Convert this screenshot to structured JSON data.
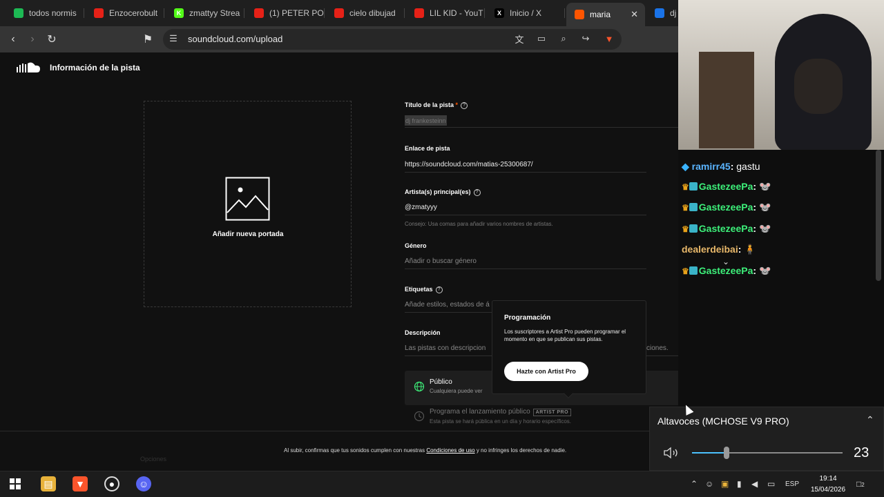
{
  "tabs": [
    {
      "label": "todos normis",
      "color": "#1db954",
      "glyph": ""
    },
    {
      "label": "Enzocerobult",
      "color": "#e62117",
      "glyph": ""
    },
    {
      "label": "zmattyy Strea",
      "color": "#53fc18",
      "glyph": "K"
    },
    {
      "label": "(1) PETER PO",
      "color": "#e62117",
      "glyph": ""
    },
    {
      "label": "cielo dibujad",
      "color": "#e62117",
      "glyph": ""
    },
    {
      "label": "LIL KID - YouT",
      "color": "#e62117",
      "glyph": ""
    },
    {
      "label": "Inicio / X",
      "color": "#000000",
      "glyph": "X"
    },
    {
      "label": "maria",
      "color": "#ff5500",
      "glyph": "",
      "active": true
    },
    {
      "label": "dj",
      "color": "#1a73e8",
      "glyph": ""
    }
  ],
  "address": {
    "url": "soundcloud.com/upload"
  },
  "page": {
    "header_title": "Información de la pista",
    "cover_label": "Añadir nueva portada",
    "title_label": "Título de la pista",
    "title_required": "*",
    "title_value": "dj frankesteinn",
    "link_label": "Enlace de pista",
    "link_value": "https://soundcloud.com/matias-25300687/",
    "artist_label": "Artista(s) principal(es)",
    "artist_value": "@zmatyyy",
    "artist_hint": "Consejo: Usa comas para añadir varios nombres de artistas.",
    "genre_label": "Género",
    "genre_placeholder": "Añadir o buscar género",
    "tags_label": "Etiquetas",
    "tags_placeholder": "Añade estilos, estados de á",
    "desc_label": "Descripción",
    "desc_placeholder": "Las pistas con descripcion",
    "desc_placeholder_tail": "ciones.",
    "privacy_title": "Público",
    "privacy_sub": "Cualquiera puede ver",
    "schedule_title": "Programa el lanzamiento público",
    "schedule_badge": "ARTIST PRO",
    "schedule_sub": "Esta pista se hará pública en un día y horario específicos.",
    "footer_prefix": "Al subir, confirmas que tus sonidos cumplen con nuestras ",
    "footer_link": "Condiciones de uso",
    "footer_suffix": " y no infringes los derechos de nadie.",
    "footer_left": "Opciones"
  },
  "popover": {
    "title": "Programación",
    "body": "Los suscriptores a Artist Pro pueden programar el momento en que se publican sus pistas.",
    "button": "Hazte con Artist Pro"
  },
  "chat": [
    {
      "user": "ramirr45",
      "color": "#5ab4ff",
      "msg": "gastu",
      "badge": "cube"
    },
    {
      "user": "GastezeePa",
      "color": "#3df07a",
      "msg": "🐭",
      "badge": "crown"
    },
    {
      "user": "GastezeePa",
      "color": "#3df07a",
      "msg": "🐭",
      "badge": "crown"
    },
    {
      "user": "GastezeePa",
      "color": "#3df07a",
      "msg": "🐭",
      "badge": "crown"
    },
    {
      "user": "dealerdeibai",
      "color": "#e8b86a",
      "msg": "🧍",
      "badge": "none"
    },
    {
      "user": "GastezeePa",
      "color": "#3df07a",
      "msg": "🐭",
      "badge": "crown"
    }
  ],
  "volume": {
    "device": "Altavoces (MCHOSE V9 PRO)",
    "level": 23,
    "level_fraction": 0.23
  },
  "taskbar": {
    "language": "ESP",
    "time": "19:14",
    "date": "15/04/2026",
    "notifications": "2"
  },
  "colors": {
    "accent": "#ff5500",
    "volume_accent": "#4cc2ff"
  }
}
